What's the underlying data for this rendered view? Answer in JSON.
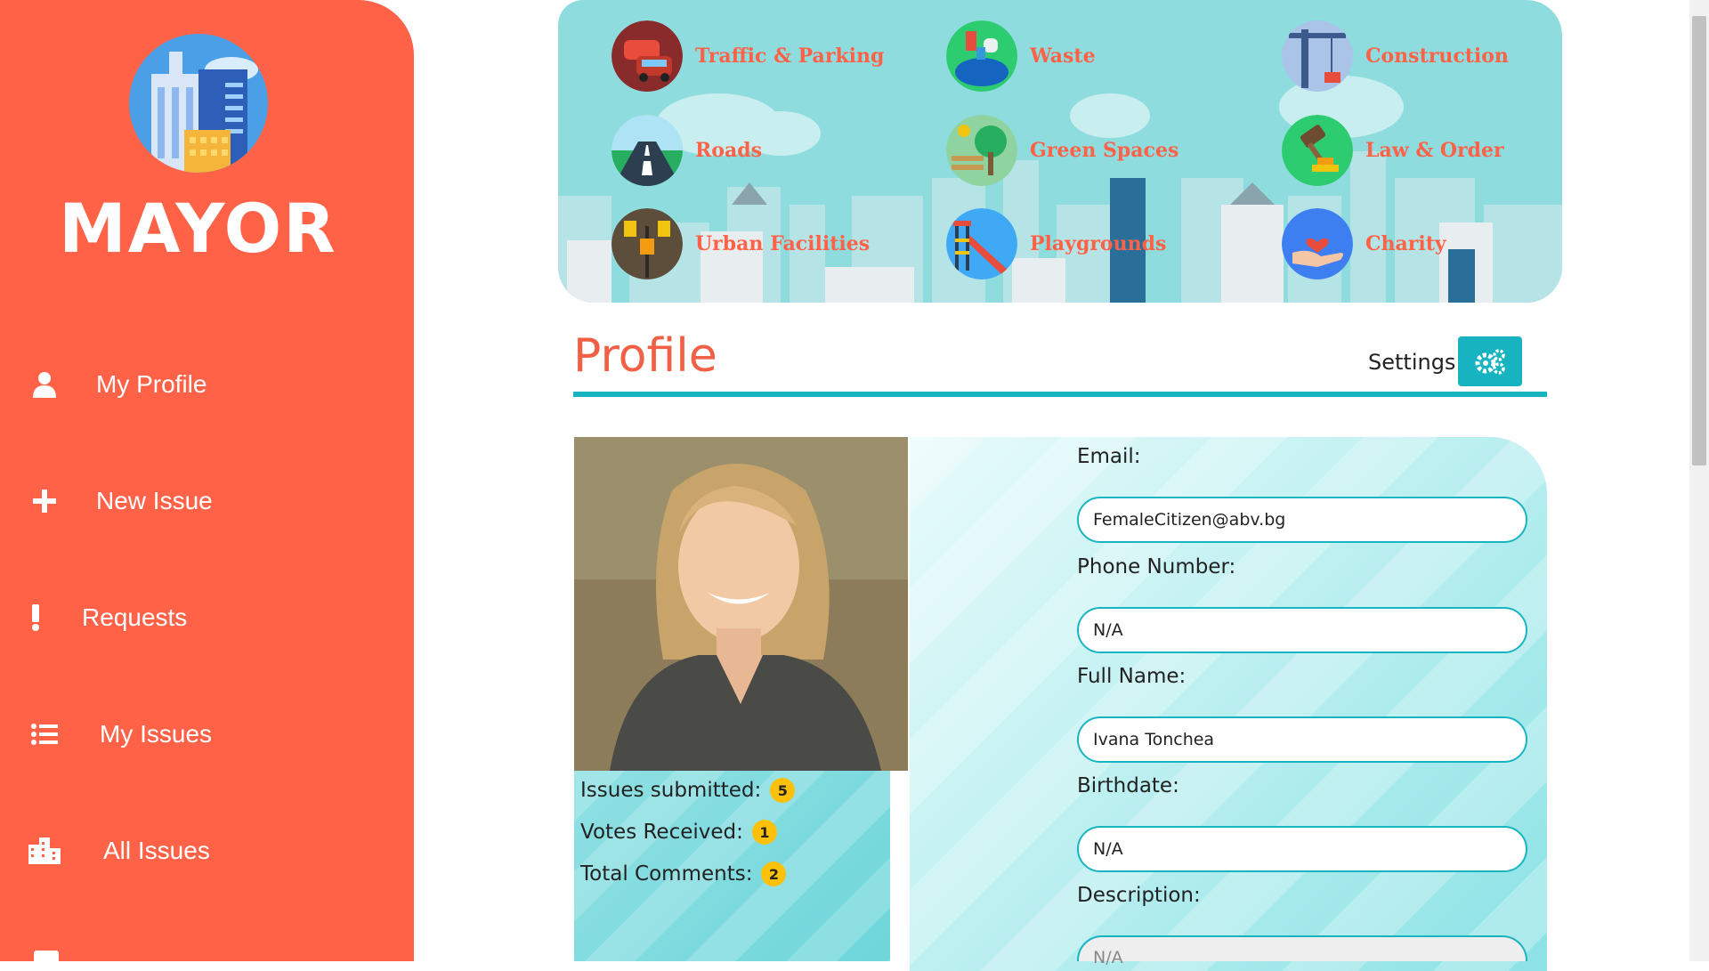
{
  "sidebar": {
    "brand": "MAYOR",
    "items": [
      {
        "label": "My Profile",
        "icon": "user-icon"
      },
      {
        "label": "New Issue",
        "icon": "plus-icon"
      },
      {
        "label": "Requests",
        "icon": "exclamation-icon"
      },
      {
        "label": "My Issues",
        "icon": "list-icon"
      },
      {
        "label": "All Issues",
        "icon": "city-icon"
      }
    ]
  },
  "categories": [
    {
      "label": "Traffic & Parking",
      "icon": "cars-icon",
      "color": "#c0392b"
    },
    {
      "label": "Waste",
      "icon": "waste-icon",
      "color": "#2ecc71"
    },
    {
      "label": "Construction",
      "icon": "crane-icon",
      "color": "#9bb5d8"
    },
    {
      "label": "Roads",
      "icon": "road-icon",
      "color": "#2c3e50"
    },
    {
      "label": "Green Spaces",
      "icon": "park-icon",
      "color": "#6abf69"
    },
    {
      "label": "Law & Order",
      "icon": "gavel-icon",
      "color": "#2ecc71"
    },
    {
      "label": "Urban Facilities",
      "icon": "streetlamp-icon",
      "color": "#5d4e3c"
    },
    {
      "label": "Playgrounds",
      "icon": "slide-icon",
      "color": "#3fa9f5"
    },
    {
      "label": "Charity",
      "icon": "heart-hand-icon",
      "color": "#3d7ef0"
    }
  ],
  "profile": {
    "title": "Profile",
    "settings_label": "Settings",
    "stats": [
      {
        "label": "Issues submitted:",
        "value": "5"
      },
      {
        "label": "Votes Received:",
        "value": "1"
      },
      {
        "label": "Total Comments:",
        "value": "2"
      }
    ],
    "fields": [
      {
        "label": "Email:",
        "value": "FemaleCitizen@abv.bg"
      },
      {
        "label": "Phone Number:",
        "value": "N/A"
      },
      {
        "label": "Full Name:",
        "value": "Ivana Tonchea"
      },
      {
        "label": "Birthdate:",
        "value": "N/A"
      },
      {
        "label": "Description:",
        "value": "N/A"
      }
    ]
  },
  "colors": {
    "sidebar": "#ff6247",
    "accent": "#19b4c2",
    "banner": "#8fdcdf",
    "badge": "#ffc107"
  }
}
